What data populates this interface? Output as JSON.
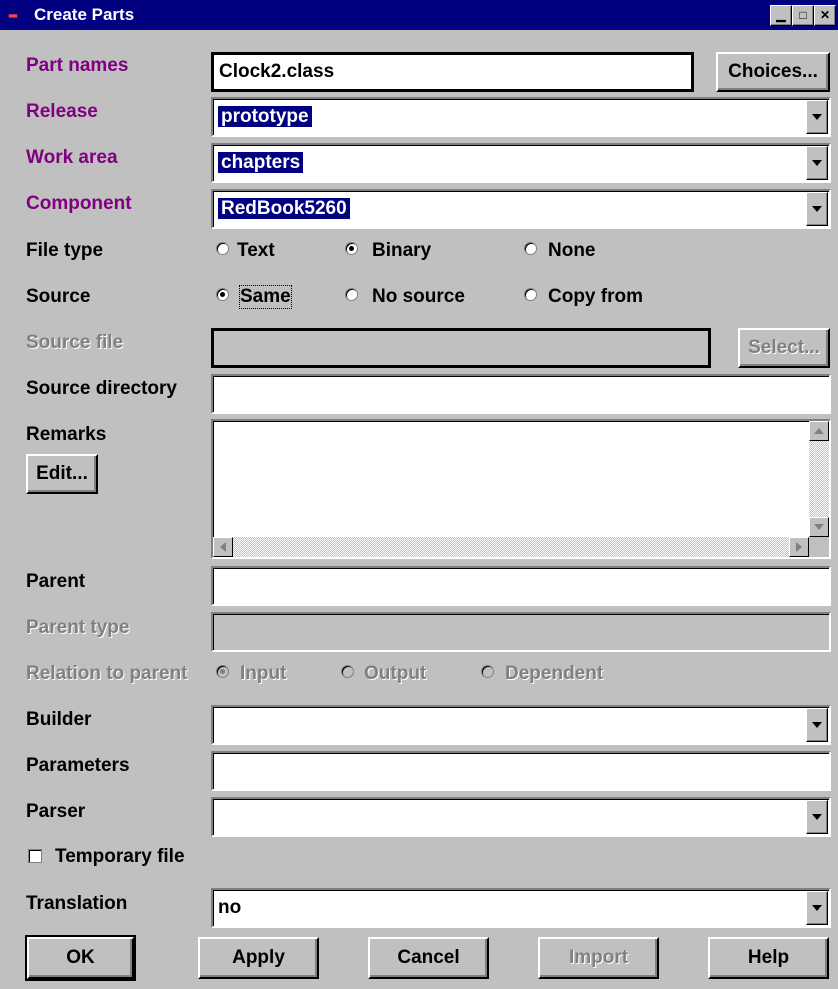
{
  "window": {
    "title": "Create Parts"
  },
  "labels": {
    "part_names": "Part names",
    "release": "Release",
    "work_area": "Work area",
    "component": "Component",
    "file_type": "File type",
    "source": "Source",
    "source_file": "Source file",
    "source_directory": "Source directory",
    "remarks": "Remarks",
    "parent": "Parent",
    "parent_type": "Parent type",
    "relation_to_parent": "Relation to parent",
    "builder": "Builder",
    "parameters": "Parameters",
    "parser": "Parser",
    "translation": "Translation"
  },
  "fields": {
    "part_names": "Clock2.class",
    "release": "prototype",
    "work_area": "chapters",
    "component": "RedBook5260",
    "translation": "no"
  },
  "file_type": {
    "options": [
      "Text",
      "Binary",
      "None"
    ],
    "selected": "Binary"
  },
  "source": {
    "options": [
      "Same",
      "No source",
      "Copy from"
    ],
    "selected": "Same"
  },
  "relation": {
    "options": [
      "Input",
      "Output",
      "Dependent"
    ],
    "selected": "Input"
  },
  "temporary_file": {
    "label": "Temporary file",
    "checked": false
  },
  "buttons": {
    "choices": "Choices...",
    "select": "Select...",
    "edit": "Edit...",
    "ok": "OK",
    "apply": "Apply",
    "cancel": "Cancel",
    "import": "Import",
    "help": "Help"
  }
}
